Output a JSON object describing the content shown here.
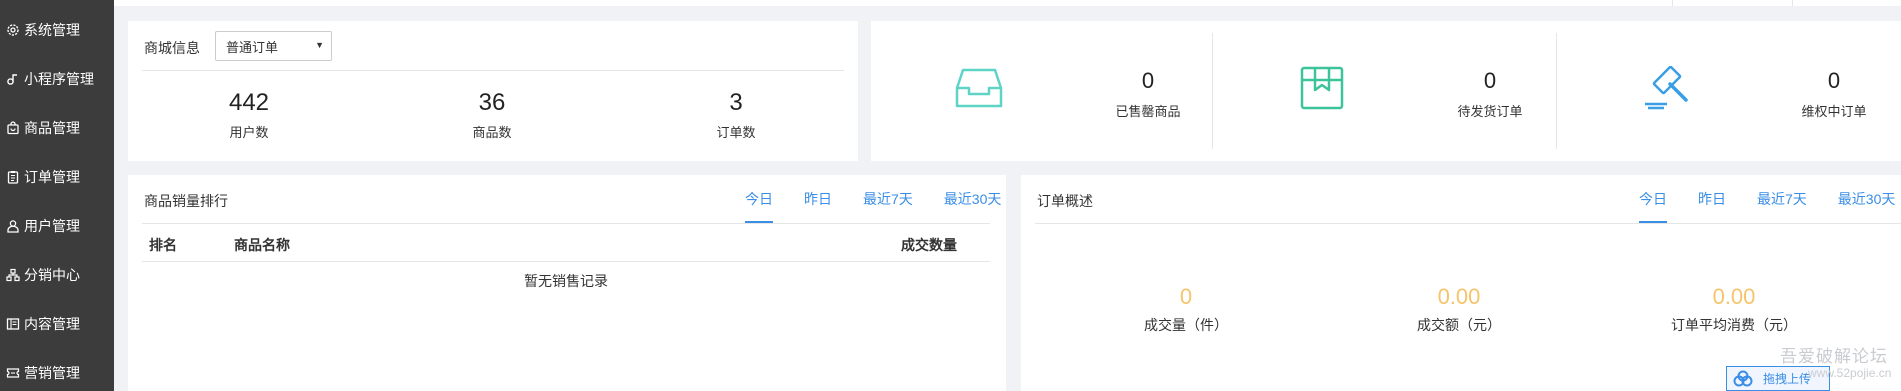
{
  "sidebar": {
    "items": [
      {
        "label": "系统管理",
        "icon": "gear-icon"
      },
      {
        "label": "小程序管理",
        "icon": "link-icon"
      },
      {
        "label": "商品管理",
        "icon": "shopping-bag-icon"
      },
      {
        "label": "订单管理",
        "icon": "clipboard-icon"
      },
      {
        "label": "用户管理",
        "icon": "user-icon"
      },
      {
        "label": "分销中心",
        "icon": "hierarchy-icon"
      },
      {
        "label": "内容管理",
        "icon": "content-icon"
      },
      {
        "label": "营销管理",
        "icon": "ticket-icon"
      }
    ]
  },
  "store": {
    "title": "商城信息",
    "order_type": "普通订单",
    "stats": [
      {
        "value": "442",
        "label": "用户数"
      },
      {
        "value": "36",
        "label": "商品数"
      },
      {
        "value": "3",
        "label": "订单数"
      }
    ]
  },
  "status": {
    "items": [
      {
        "value": "0",
        "label": "已售罄商品",
        "icon": "inbox-icon",
        "color": "#5ed3c6"
      },
      {
        "value": "0",
        "label": "待发货订单",
        "icon": "package-icon",
        "color": "#3cc39a"
      },
      {
        "value": "0",
        "label": "维权中订单",
        "icon": "gavel-icon",
        "color": "#3a9ee6"
      }
    ]
  },
  "ranking": {
    "title": "商品销量排行",
    "tabs": [
      "今日",
      "昨日",
      "最近7天",
      "最近30天"
    ],
    "active_tab": "今日",
    "columns": [
      "排名",
      "商品名称",
      "成交数量"
    ],
    "empty_text": "暂无销售记录"
  },
  "overview": {
    "title": "订单概述",
    "tabs": [
      "今日",
      "昨日",
      "最近7天",
      "最近30天"
    ],
    "active_tab": "今日",
    "metrics": [
      {
        "value": "0",
        "label": "成交量（件）"
      },
      {
        "value": "0.00",
        "label": "成交额（元）"
      },
      {
        "value": "0.00",
        "label": "订单平均消费（元）"
      }
    ]
  },
  "watermark": {
    "line1": "吾爱破解论坛",
    "line2": "www.52pojie.cn"
  },
  "share_button": {
    "label": "拖拽上传"
  },
  "colors": {
    "sidebar_bg": "#3c3c3c",
    "accent": "#3a8ee6",
    "metric_yellow": "#f5c46b",
    "page_bg": "#f0f2f5"
  }
}
